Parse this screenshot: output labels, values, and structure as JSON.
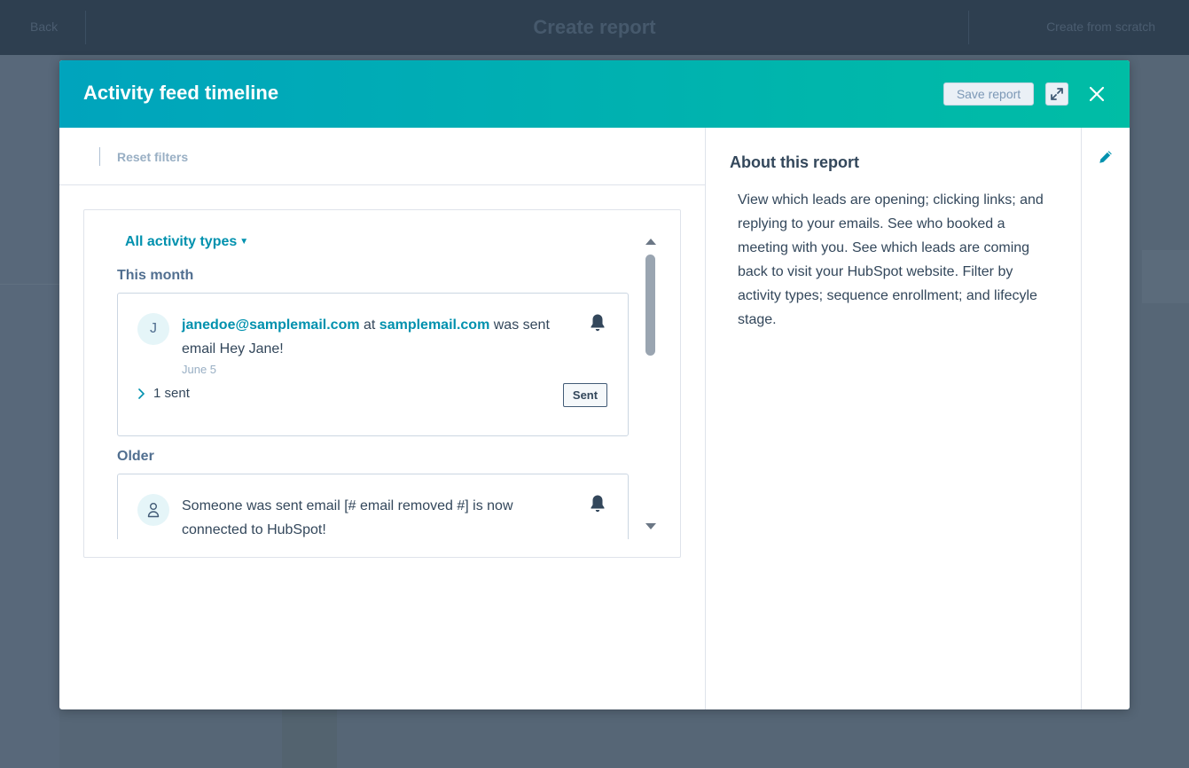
{
  "background": {
    "back_label": "Back",
    "title": "Create report",
    "next_label": "Create from scratch"
  },
  "modal": {
    "title": "Activity feed timeline",
    "save_label": "Save report",
    "expand_icon": "expand-icon",
    "close_icon": "close-icon"
  },
  "filters": {
    "reset_label": "Reset filters"
  },
  "feed": {
    "activity_filter": "All activity types",
    "sections": [
      {
        "label": "This month",
        "item": {
          "avatar": "J",
          "email_link": "janedoe@samplemail.com",
          "at_text": " at ",
          "domain_link": "samplemail.com",
          "suffix_text": " was sent email Hey Jane!",
          "date": "June 5",
          "expander_label": "1 sent",
          "badge": "Sent"
        }
      },
      {
        "label": "Older",
        "item": {
          "avatar_icon": "person-icon",
          "text": "Someone was sent email [# email removed #] is now connected to HubSpot!"
        }
      }
    ]
  },
  "about": {
    "title": "About this report",
    "description": "View which leads are opening; clicking links; and replying to your emails. See who booked a meeting with you. See which leads are coming back to visit your HubSpot website. Filter by activity types; sequence enrollment; and lifecyle stage."
  },
  "colors": {
    "header_gradient_start": "#00a4bd",
    "header_gradient_end": "#00bda5",
    "link": "#0091ae",
    "text": "#33475b"
  }
}
